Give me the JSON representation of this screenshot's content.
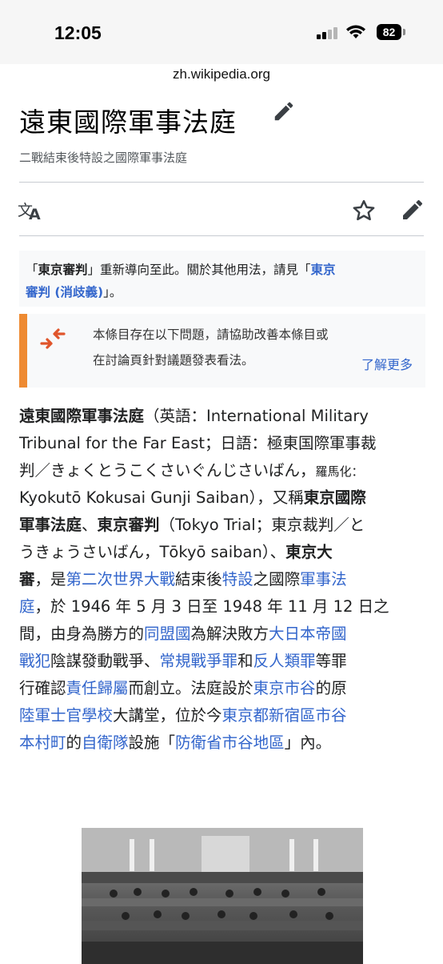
{
  "status_bar": {
    "time": "12:05",
    "battery": "82"
  },
  "browser": {
    "url": "zh.wikipedia.org"
  },
  "header": {
    "title": "遠東國際軍事法庭",
    "subtitle": "二戰結束後特設之國際軍事法庭"
  },
  "hatnote": {
    "p1": "「",
    "b1": "東京審判",
    "p2": "」重新導向至此。關於其他用法，請見「",
    "link1": "東京",
    "link2": "審判 (消歧義)",
    "p3": "」。"
  },
  "issue_box": {
    "line1": "本條目存在以下問題，請協助改善本條目或",
    "line2": "在討論頁針對議題發表看法。",
    "learn_more": "了解更多"
  },
  "article": {
    "l1_b": "遠東國際軍事法庭",
    "l1_t": "（英語：International Military",
    "l2_t": "Tribunal for the Far East；日語：極東国際軍事裁",
    "l3_t": "判／きょくとうこくさいぐんじさいばん，",
    "l3_s": "羅馬化：",
    "l4_t": "Kyokutō Kokusai Gunji Saiban），又稱",
    "l4_b": "東京國際",
    "l5_b1": "軍事法庭",
    "l5_t1": "、",
    "l5_b2": "東京審判",
    "l5_t2": "（Tokyo Trial；東京裁判／と",
    "l6_t": "うきょうさいばん，Tōkyō saiban）、",
    "l6_b": "東京大",
    "l7_b": "審",
    "l7_t1": "，是",
    "l7_a1": "第二次世界大戰",
    "l7_t2": "結束後",
    "l7_a2": "特設",
    "l7_t3": "之國際",
    "l7_a3": "軍事法",
    "l8_a1": "庭",
    "l8_t1": "，於 1946 年 5 月 3 日至 1948 年 11 月 12 日之",
    "l9_t1": "間，由身為勝方的",
    "l9_a1": "同盟國",
    "l9_t2": "為解決敗方",
    "l9_a2": "大日本帝國",
    "l10_a1": "戰犯",
    "l10_t1": "陰謀發動戰爭、",
    "l10_a2": "常規戰爭罪",
    "l10_t2": "和",
    "l10_a3": "反人類罪",
    "l10_t3": "等罪",
    "l11_t1": "行確認",
    "l11_a1": "責任歸屬",
    "l11_t2": "而創立。法庭設於",
    "l11_a2": "東京市谷",
    "l11_t3": "的原",
    "l12_a1": "陸軍士官學校",
    "l12_t1": "大講堂，位於今",
    "l12_a2": "東京都新宿區市谷",
    "l13_a1": "本村町",
    "l13_t1": "的",
    "l13_a2": "自衛隊",
    "l13_t2": "設施「",
    "l13_a3": "防衛省市谷地區",
    "l13_t3": "」內。"
  },
  "colors": {
    "link": "#3366cc",
    "accent_orange": "#ee8a31",
    "text": "#202122"
  }
}
